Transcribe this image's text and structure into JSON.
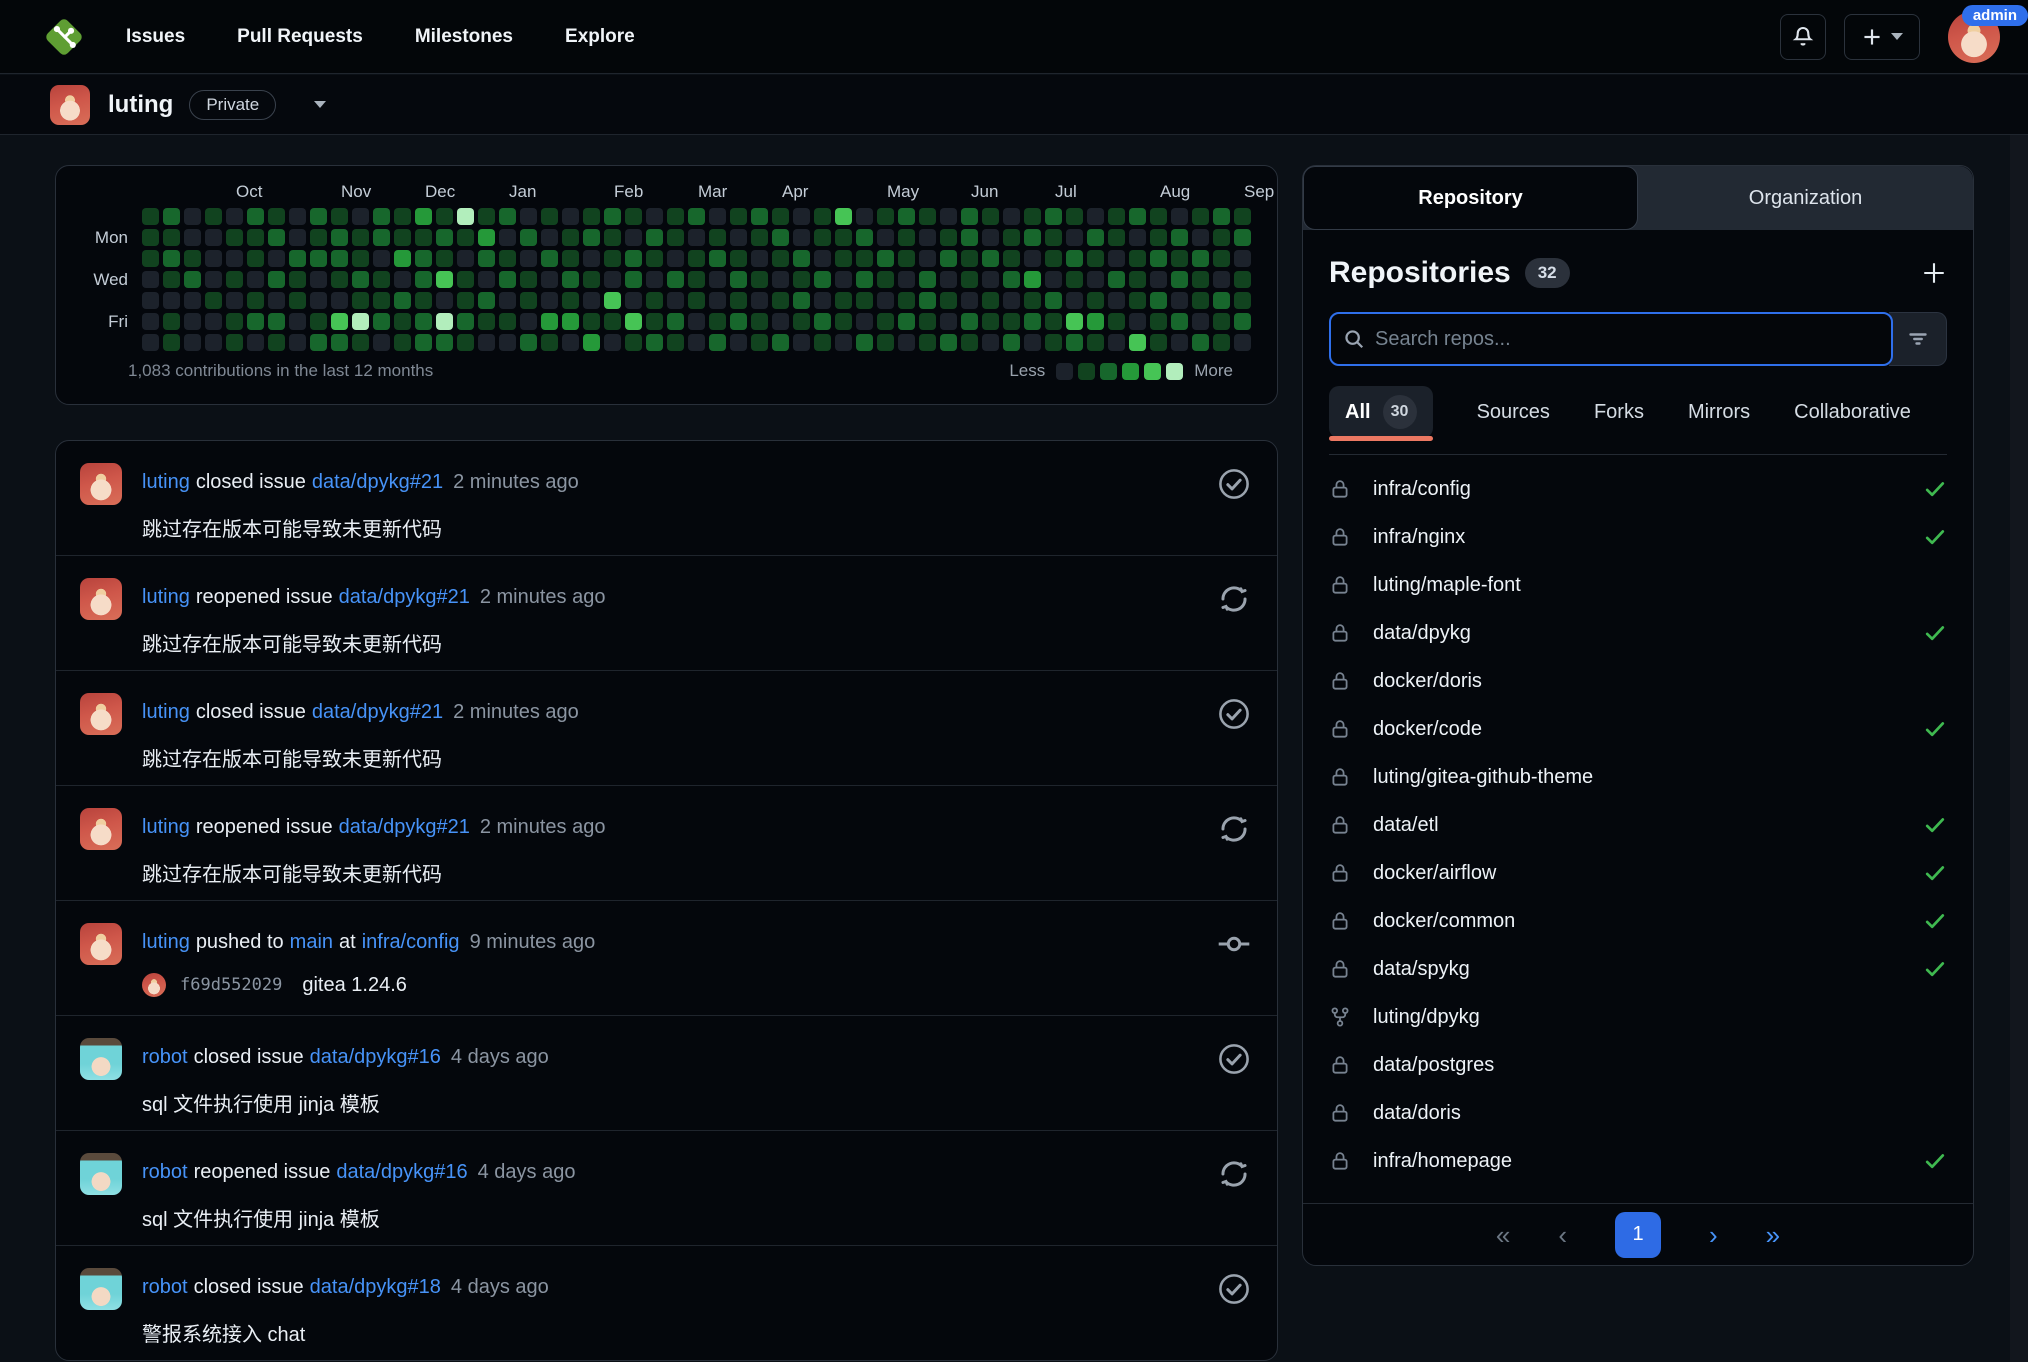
{
  "colors": {
    "link_blue": "#4793f8",
    "success_green": "#3fb950",
    "active_tab_underline": "#ec7862",
    "pagination_current_bg": "#2e6be5",
    "admin_badge_bg": "#2f6feb"
  },
  "navbar": {
    "brand_icon": "git-logo",
    "links": [
      "Issues",
      "Pull Requests",
      "Milestones",
      "Explore"
    ],
    "admin_badge": "admin"
  },
  "profile_header": {
    "username": "luting",
    "badge": "Private"
  },
  "heatmap": {
    "type": "heatmap",
    "total_label": "1,083 contributions in the last 12 months",
    "months": [
      {
        "label": "Oct",
        "col": 4
      },
      {
        "label": "Nov",
        "col": 9
      },
      {
        "label": "Dec",
        "col": 13
      },
      {
        "label": "Jan",
        "col": 17
      },
      {
        "label": "Feb",
        "col": 22
      },
      {
        "label": "Mar",
        "col": 26
      },
      {
        "label": "Apr",
        "col": 30
      },
      {
        "label": "May",
        "col": 35
      },
      {
        "label": "Jun",
        "col": 39
      },
      {
        "label": "Jul",
        "col": 43
      },
      {
        "label": "Aug",
        "col": 48
      },
      {
        "label": "Sep",
        "col": 52
      }
    ],
    "day_labels": [
      {
        "label": "Mon",
        "row": 1
      },
      {
        "label": "Wed",
        "row": 3
      },
      {
        "label": "Fri",
        "row": 5
      }
    ],
    "palette": [
      "#1c222b",
      "#11431f",
      "#17672c",
      "#259939",
      "#46c455",
      "#b2eebc"
    ],
    "legend": {
      "less": "Less",
      "more": "More",
      "colors": [
        "#1c222b",
        "#11431f",
        "#17672c",
        "#259939",
        "#46c455",
        "#b2eebc"
      ]
    },
    "weeks": [
      "1110000",
      "2121011",
      "0012000",
      "1000100",
      "0101011",
      "2110120",
      "1202021",
      "0021100",
      "2120012",
      "1221042",
      "0112151",
      "2201120",
      "1130211",
      "3122122",
      "1214052",
      "5101121",
      "1320210",
      "2012010",
      "0201102",
      "1020031",
      "0112130",
      "1201013",
      "2110410",
      "1022041",
      "0210112",
      "1102021",
      "2011100",
      "0120012",
      "1012120",
      "2101011",
      "1210102",
      "0021210",
      "1102021",
      "4110110",
      "0212102",
      "1021011",
      "2110120",
      "1002211",
      "0120102",
      "2211021",
      "1020110",
      "0112012",
      "1203120",
      "2110211",
      "1021042",
      "0210131",
      "1102010",
      "2011104",
      "1120211",
      "0212020",
      "1021102",
      "2110211",
      "1201120"
    ]
  },
  "feed": {
    "items": [
      {
        "user": "luting",
        "avatar": "luting",
        "action": "closed issue",
        "repo": "data/dpykg#21",
        "time": "2 minutes ago",
        "body": "跳过存在版本可能导致未更新代码",
        "icon": "check-circle"
      },
      {
        "user": "luting",
        "avatar": "luting",
        "action": "reopened issue",
        "repo": "data/dpykg#21",
        "time": "2 minutes ago",
        "body": "跳过存在版本可能导致未更新代码",
        "icon": "reopen"
      },
      {
        "user": "luting",
        "avatar": "luting",
        "action": "closed issue",
        "repo": "data/dpykg#21",
        "time": "2 minutes ago",
        "body": "跳过存在版本可能导致未更新代码",
        "icon": "check-circle"
      },
      {
        "user": "luting",
        "avatar": "luting",
        "action": "reopened issue",
        "repo": "data/dpykg#21",
        "time": "2 minutes ago",
        "body": "跳过存在版本可能导致未更新代码",
        "icon": "reopen"
      },
      {
        "user": "luting",
        "avatar": "luting",
        "action": "pushed to",
        "branch": "main",
        "at_word": "at",
        "repo": "infra/config",
        "time": "9 minutes ago",
        "commit": {
          "hash": "f69d552029",
          "message": "gitea 1.24.6"
        },
        "icon": "commit"
      },
      {
        "user": "robot",
        "avatar": "robot",
        "action": "closed issue",
        "repo": "data/dpykg#16",
        "time": "4 days ago",
        "body": "sql 文件执行使用 jinja 模板",
        "icon": "check-circle"
      },
      {
        "user": "robot",
        "avatar": "robot",
        "action": "reopened issue",
        "repo": "data/dpykg#16",
        "time": "4 days ago",
        "body": "sql 文件执行使用 jinja 模板",
        "icon": "reopen"
      },
      {
        "user": "robot",
        "avatar": "robot",
        "action": "closed issue",
        "repo": "data/dpykg#18",
        "time": "4 days ago",
        "body": "警报系统接入 chat",
        "icon": "check-circle"
      }
    ]
  },
  "repo_panel": {
    "tabs": [
      {
        "label": "Repository",
        "active": true
      },
      {
        "label": "Organization",
        "active": false
      }
    ],
    "heading": "Repositories",
    "count": "32",
    "add_icon": "plus-icon",
    "search": {
      "placeholder": "Search repos...",
      "filter_icon": "filter-icon"
    },
    "filters": [
      {
        "label": "All",
        "badge": "30",
        "active": true
      },
      {
        "label": "Sources"
      },
      {
        "label": "Forks"
      },
      {
        "label": "Mirrors"
      },
      {
        "label": "Collaborative"
      }
    ],
    "repos": [
      {
        "name": "infra/config",
        "icon": "lock",
        "done": true
      },
      {
        "name": "infra/nginx",
        "icon": "lock",
        "done": true
      },
      {
        "name": "luting/maple-font",
        "icon": "lock",
        "done": false
      },
      {
        "name": "data/dpykg",
        "icon": "lock",
        "done": true
      },
      {
        "name": "docker/doris",
        "icon": "lock",
        "done": false
      },
      {
        "name": "docker/code",
        "icon": "lock",
        "done": true
      },
      {
        "name": "luting/gitea-github-theme",
        "icon": "lock",
        "done": false
      },
      {
        "name": "data/etl",
        "icon": "lock",
        "done": true
      },
      {
        "name": "docker/airflow",
        "icon": "lock",
        "done": true
      },
      {
        "name": "docker/common",
        "icon": "lock",
        "done": true
      },
      {
        "name": "data/spykg",
        "icon": "lock",
        "done": true
      },
      {
        "name": "luting/dpykg",
        "icon": "fork",
        "done": false
      },
      {
        "name": "data/postgres",
        "icon": "lock",
        "done": false
      },
      {
        "name": "data/doris",
        "icon": "lock",
        "done": false
      },
      {
        "name": "infra/homepage",
        "icon": "lock",
        "done": true
      }
    ],
    "pagination": {
      "first": "«",
      "prev": "‹",
      "current": "1",
      "next": "›",
      "last": "»"
    }
  }
}
